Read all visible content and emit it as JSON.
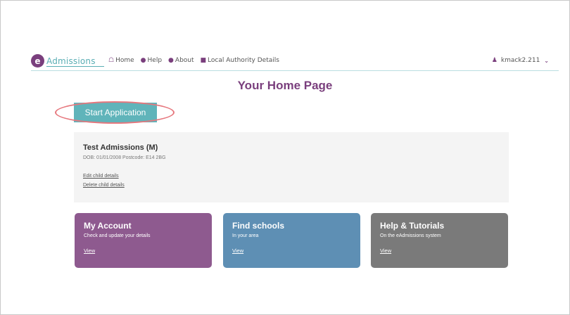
{
  "logo": {
    "badge": "e",
    "text": "Admissions"
  },
  "nav": [
    {
      "icon": "home-icon",
      "glyph": "☖",
      "label": "Home"
    },
    {
      "icon": "help-icon",
      "glyph": "●",
      "label": "Help"
    },
    {
      "icon": "info-icon",
      "glyph": "●",
      "label": "About"
    },
    {
      "icon": "building-icon",
      "glyph": "■",
      "label": "Local Authority Details"
    }
  ],
  "user": {
    "name": "kmack2.211",
    "chevron": "⌄"
  },
  "page_title": "Your Home Page",
  "start_button": "Start Application",
  "child": {
    "name": "Test Admissions (M)",
    "meta": "DOB: 01/01/2008 Postcode: E14 2BG",
    "edit_label": "Edit child details",
    "delete_label": "Delete child details"
  },
  "tiles": [
    {
      "title": "My Account",
      "subtitle": "Check and update your details",
      "link": "View",
      "color": "#8e5a8f"
    },
    {
      "title": "Find schools",
      "subtitle": "In your area",
      "link": "View",
      "color": "#5e8fb4"
    },
    {
      "title": "Help & Tutorials",
      "subtitle": "On the eAdmissions system",
      "link": "View",
      "color": "#7a7a7a"
    }
  ],
  "colors": {
    "brand": "#7a3f7d",
    "accent": "#60b4ba",
    "highlight": "#e6777d"
  }
}
